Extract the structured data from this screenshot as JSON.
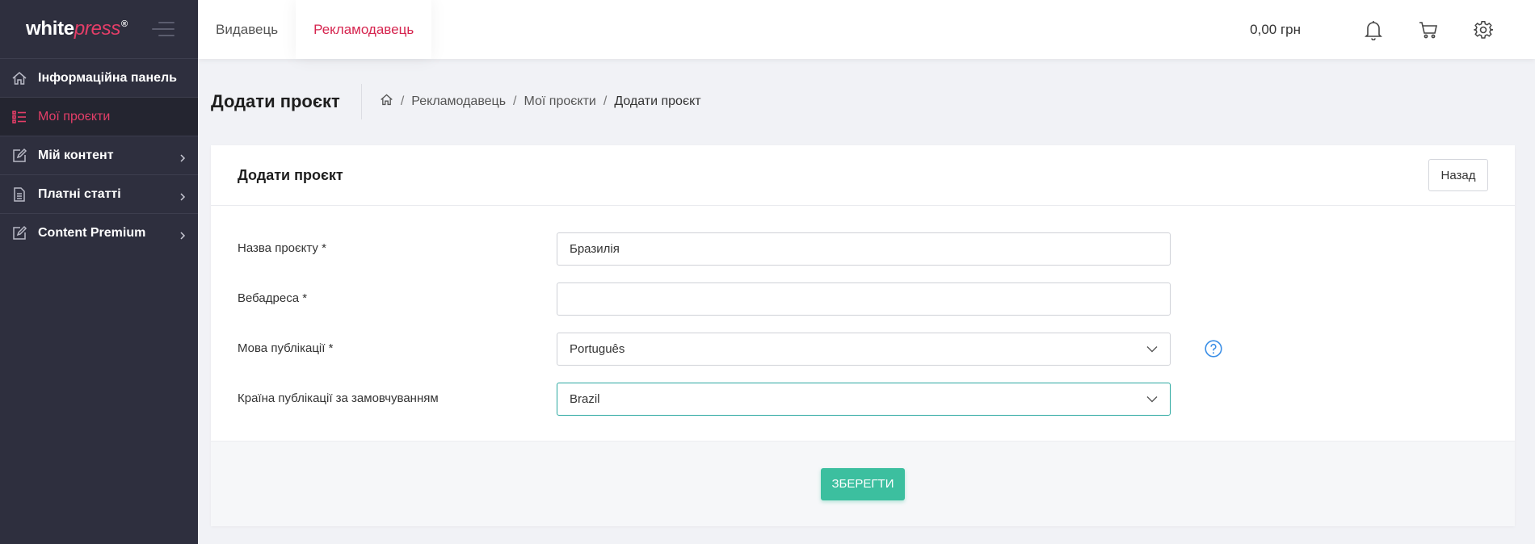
{
  "brand": {
    "logo_white": "white",
    "logo_press": "press",
    "logo_mark": "®"
  },
  "sidebar": {
    "items": [
      {
        "label": "Інформаційна панель",
        "icon": "home-icon",
        "active": false,
        "has_submenu": false
      },
      {
        "label": "Мої проєкти",
        "icon": "list-icon",
        "active": true,
        "has_submenu": false
      },
      {
        "label": "Мій контент",
        "icon": "edit-icon",
        "active": false,
        "has_submenu": true
      },
      {
        "label": "Платні статті",
        "icon": "document-icon",
        "active": false,
        "has_submenu": true
      },
      {
        "label": "Content Premium",
        "icon": "edit-icon",
        "active": false,
        "has_submenu": true
      }
    ]
  },
  "topbar": {
    "tabs": [
      {
        "label": "Видавець",
        "active": false
      },
      {
        "label": "Рекламодавець",
        "active": true
      }
    ],
    "balance": "0,00 грн",
    "icons": [
      "bell-icon",
      "cart-icon",
      "gear-icon"
    ]
  },
  "page": {
    "title": "Додати проєкт",
    "breadcrumbs": [
      "Рекламодавець",
      "Мої проєкти",
      "Додати проєкт"
    ]
  },
  "card": {
    "title": "Додати проєкт",
    "back_label": "Назад",
    "fields": [
      {
        "label": "Назва проєкту *",
        "value": "Бразилія",
        "type": "text"
      },
      {
        "label": "Вебадреса *",
        "value": "",
        "type": "text"
      },
      {
        "label": "Мова публікації *",
        "value": "Português",
        "type": "select"
      },
      {
        "label": "Країна публікації за замовчуванням",
        "value": "Brazil",
        "type": "select"
      }
    ],
    "save_label": "ЗБЕРЕГТИ"
  },
  "colors": {
    "accent": "#d6254f",
    "sidebar_bg": "#2e2f3e",
    "save_button": "#3cbf9f",
    "focus_border": "#2aa8a0",
    "help_icon": "#3a8ee6"
  }
}
